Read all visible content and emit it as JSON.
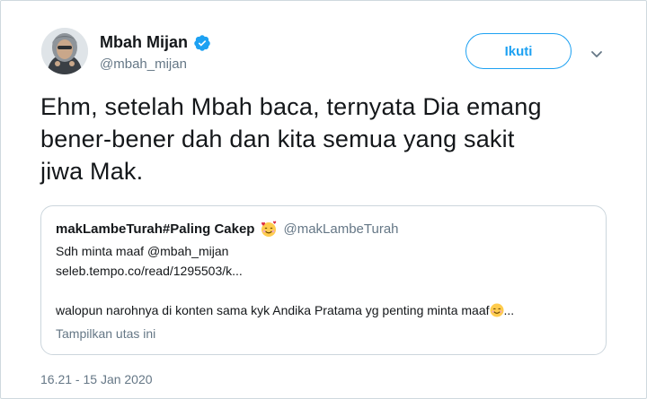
{
  "author": {
    "name": "Mbah Mijan",
    "handle": "@mbah_mijan",
    "verified": true,
    "avatar_icon": "avatar-hoodie-person"
  },
  "actions": {
    "follow_label": "Ikuti",
    "more_icon": "chevron-down-icon"
  },
  "tweet": {
    "line1": "Ehm, setelah Mbah baca, ternyata Dia emang",
    "line2": "bener-bener dah dan kita semua yang sakit",
    "line3": "jiwa Mak."
  },
  "quoted_tweet": {
    "name": "makLambeTurah#Paling Cakep",
    "name_emoji": "smiling-face-with-hearts",
    "handle": "@makLambeTurah",
    "text_prefix": "Sdh minta maaf ",
    "mention": "@mbah_mijan",
    "link": "seleb.tempo.co/read/1295503/k...",
    "body": "walopun narohnya di konten sama kyk Andika Pratama yg penting minta maaf",
    "body_emoji": "smiling-face-with-smiling-eyes",
    "body_ellipsis": "...",
    "show_thread": "Tampilkan utas ini"
  },
  "timestamp": "16.21 - 15 Jan 2020",
  "colors": {
    "accent": "#1da1f2",
    "secondary_text": "#657786",
    "border": "#ccd6dd"
  }
}
